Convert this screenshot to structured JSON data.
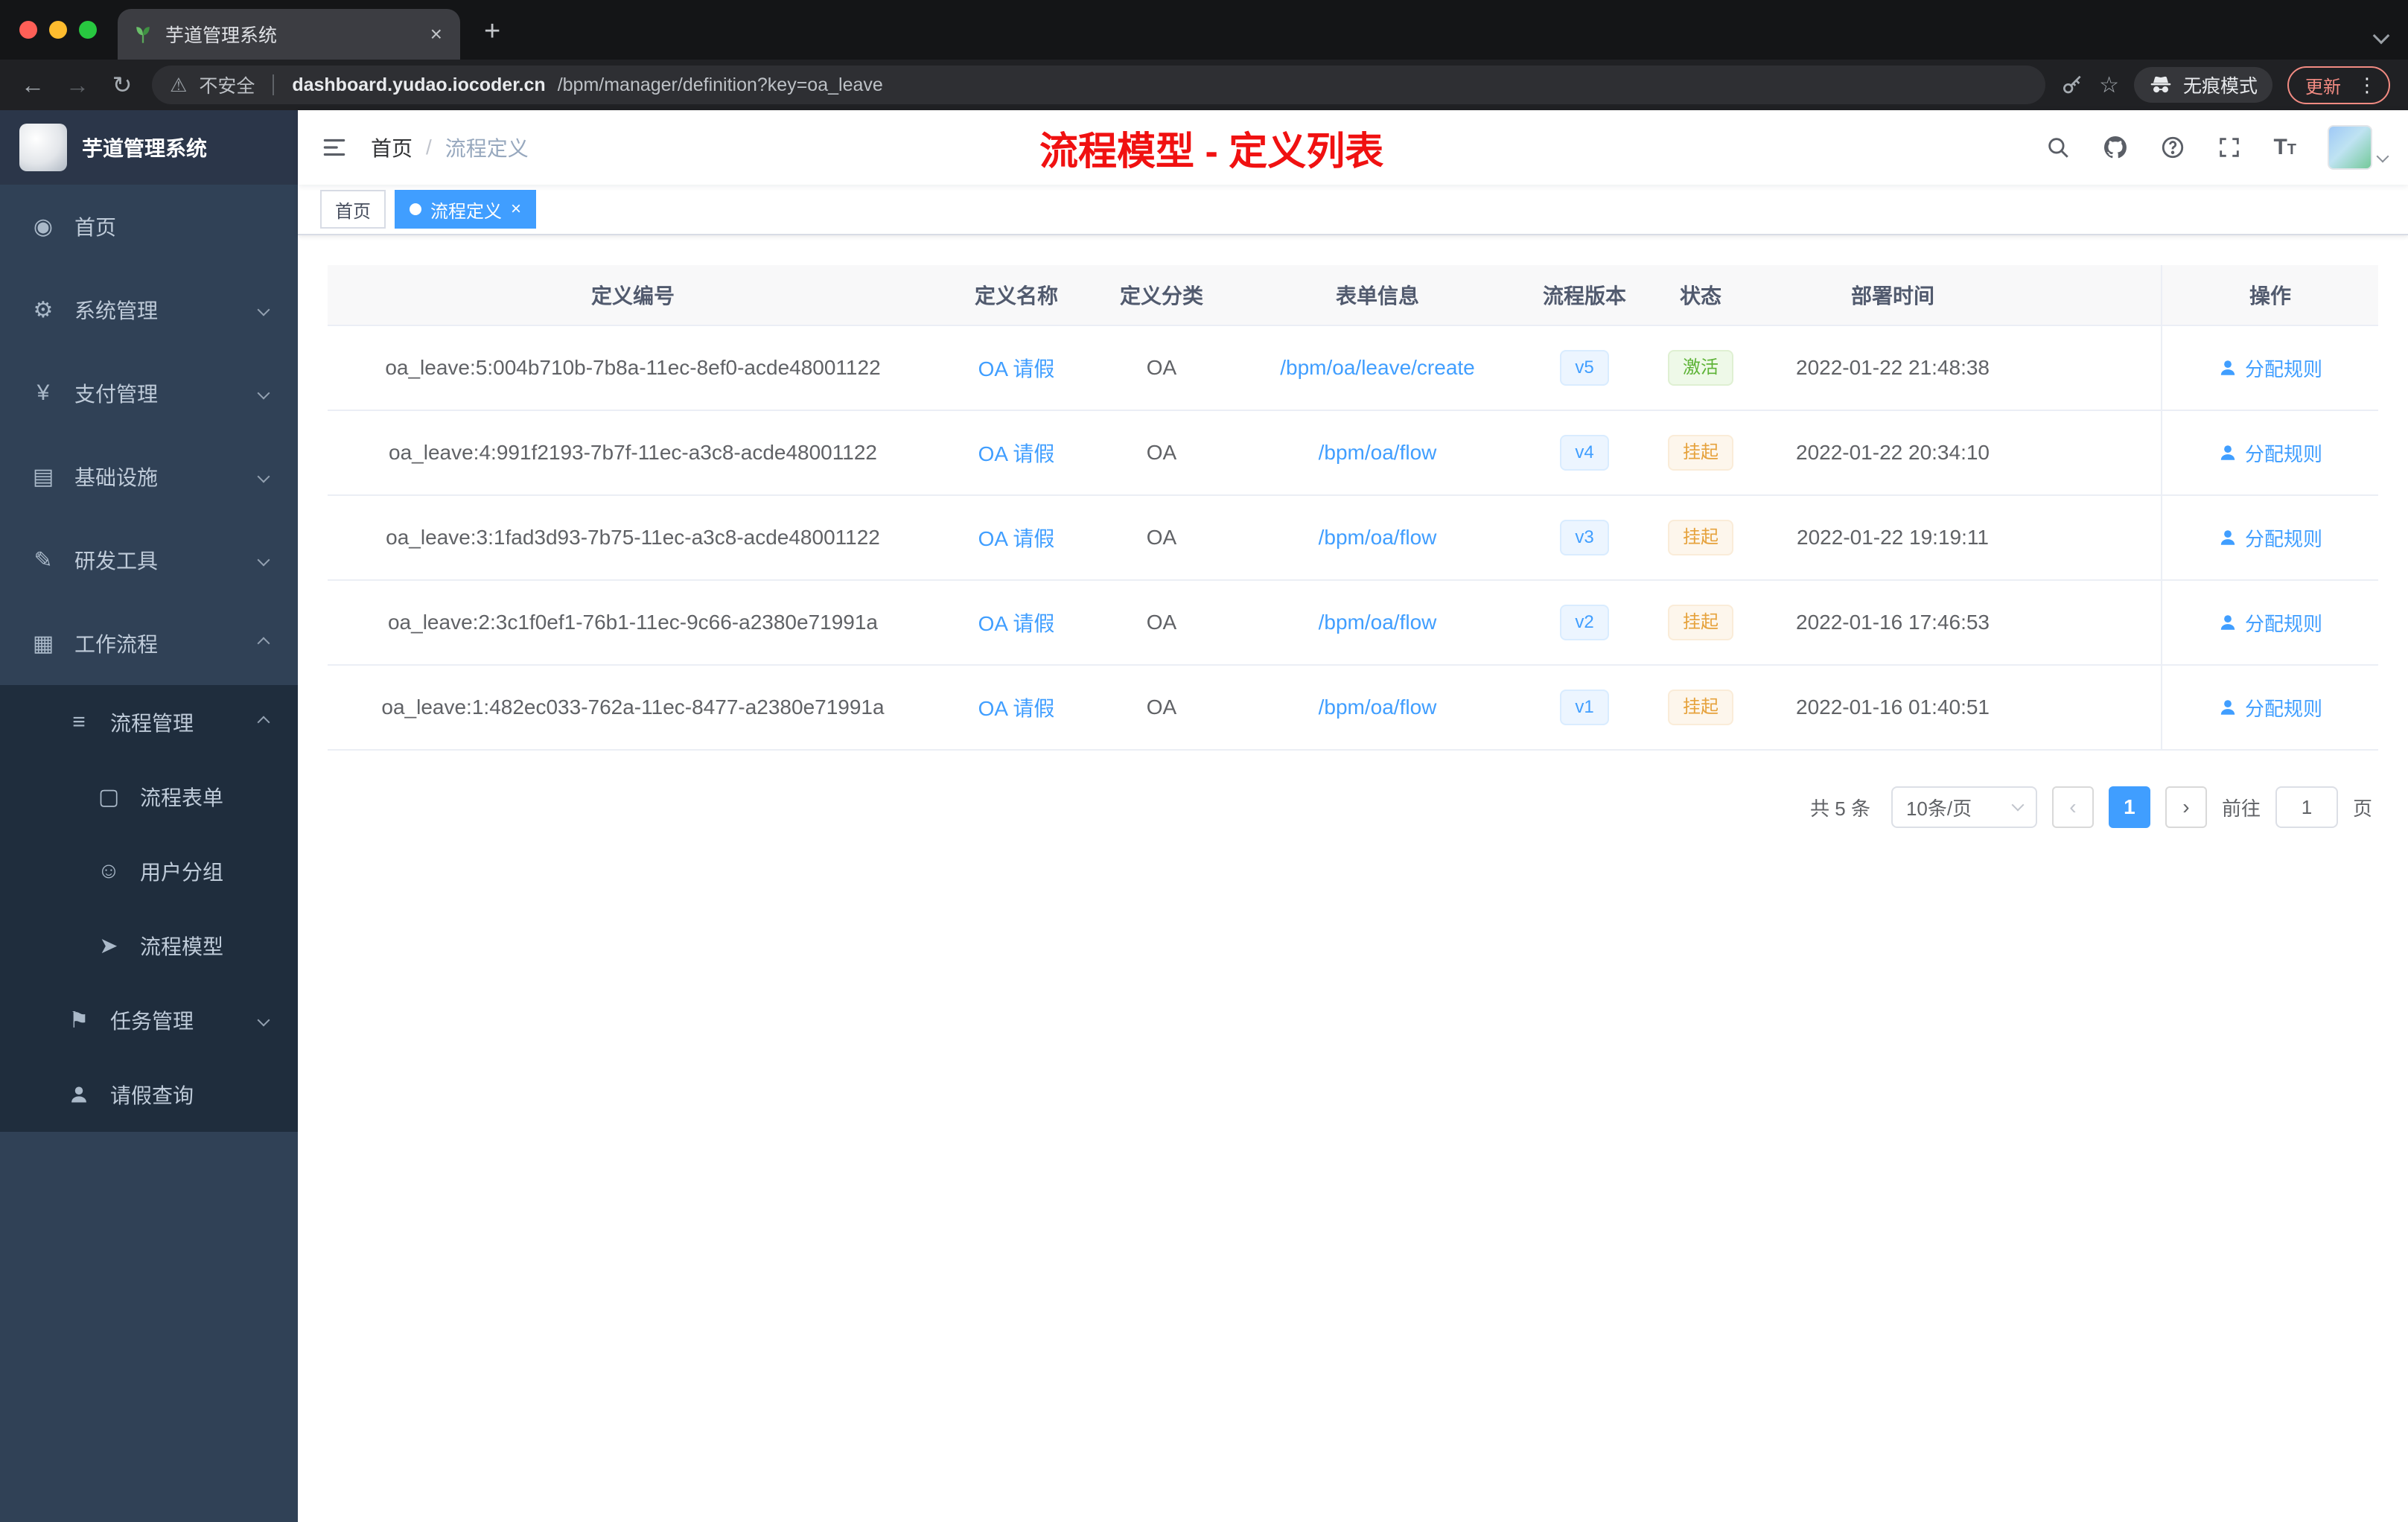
{
  "browser": {
    "tab_title": "芋道管理系统",
    "security_label": "不安全",
    "url_host": "dashboard.yudao.iocoder.cn",
    "url_path": "/bpm/manager/definition?key=oa_leave",
    "incognito_label": "无痕模式",
    "update_label": "更新"
  },
  "icons": {
    "back": "←",
    "forward": "→",
    "reload": "↻",
    "warning": "⚠",
    "star": "☆",
    "kebab": "⋮",
    "new_tab": "+",
    "close": "×",
    "prev": "‹",
    "next": "›",
    "font_large": "T",
    "font_small": "T"
  },
  "sidebar": {
    "app_title": "芋道管理系统",
    "items": [
      {
        "label": "首页",
        "icon": "◉"
      },
      {
        "label": "系统管理",
        "icon": "⚙",
        "chevron": "down"
      },
      {
        "label": "支付管理",
        "icon": "¥",
        "chevron": "down"
      },
      {
        "label": "基础设施",
        "icon": "▤",
        "chevron": "down"
      },
      {
        "label": "研发工具",
        "icon": "✎",
        "chevron": "down"
      },
      {
        "label": "工作流程",
        "icon": "▦",
        "chevron": "up"
      },
      {
        "label": "流程管理",
        "icon": "≡",
        "chevron": "up",
        "level": 2
      },
      {
        "label": "流程表单",
        "icon": "▢",
        "level": 3
      },
      {
        "label": "用户分组",
        "icon": "☺",
        "level": 3
      },
      {
        "label": "流程模型",
        "icon": "➤",
        "level": 3
      },
      {
        "label": "任务管理",
        "icon": "⚑",
        "chevron": "down",
        "level": 2
      },
      {
        "label": "请假查询",
        "icon": "person",
        "level": 2
      }
    ]
  },
  "header": {
    "breadcrumb_home": "首页",
    "breadcrumb_sep": "/",
    "breadcrumb_current": "流程定义",
    "annotation": "流程模型 - 定义列表"
  },
  "tags": {
    "home": "首页",
    "active": "流程定义"
  },
  "table": {
    "columns": [
      "定义编号",
      "定义名称",
      "定义分类",
      "表单信息",
      "流程版本",
      "状态",
      "部署时间",
      "操作"
    ],
    "rows": [
      {
        "id": "oa_leave:5:004b710b-7b8a-11ec-8ef0-acde48001122",
        "name": "OA 请假",
        "category": "OA",
        "form": "/bpm/oa/leave/create",
        "version": "v5",
        "status": "激活",
        "status_type": "success",
        "deploy_time": "2022-01-22 21:48:38",
        "action": "分配规则"
      },
      {
        "id": "oa_leave:4:991f2193-7b7f-11ec-a3c8-acde48001122",
        "name": "OA 请假",
        "category": "OA",
        "form": "/bpm/oa/flow",
        "version": "v4",
        "status": "挂起",
        "status_type": "warning",
        "deploy_time": "2022-01-22 20:34:10",
        "action": "分配规则"
      },
      {
        "id": "oa_leave:3:1fad3d93-7b75-11ec-a3c8-acde48001122",
        "name": "OA 请假",
        "category": "OA",
        "form": "/bpm/oa/flow",
        "version": "v3",
        "status": "挂起",
        "status_type": "warning",
        "deploy_time": "2022-01-22 19:19:11",
        "action": "分配规则"
      },
      {
        "id": "oa_leave:2:3c1f0ef1-76b1-11ec-9c66-a2380e71991a",
        "name": "OA 请假",
        "category": "OA",
        "form": "/bpm/oa/flow",
        "version": "v2",
        "status": "挂起",
        "status_type": "warning",
        "deploy_time": "2022-01-16 17:46:53",
        "action": "分配规则"
      },
      {
        "id": "oa_leave:1:482ec033-762a-11ec-8477-a2380e71991a",
        "name": "OA 请假",
        "category": "OA",
        "form": "/bpm/oa/flow",
        "version": "v1",
        "status": "挂起",
        "status_type": "warning",
        "deploy_time": "2022-01-16 01:40:51",
        "action": "分配规则"
      }
    ]
  },
  "pagination": {
    "total_label": "共 5 条",
    "page_size_label": "10条/页",
    "page": "1",
    "goto_label": "前往",
    "goto_value": "1",
    "unit_label": "页"
  },
  "colors": {
    "accent": "#409eff",
    "sidebar_bg": "#304156",
    "submenu_bg": "#1f2d3d",
    "success": "#67c23a",
    "warning": "#e6a23c",
    "annotation_red": "#f01111"
  }
}
